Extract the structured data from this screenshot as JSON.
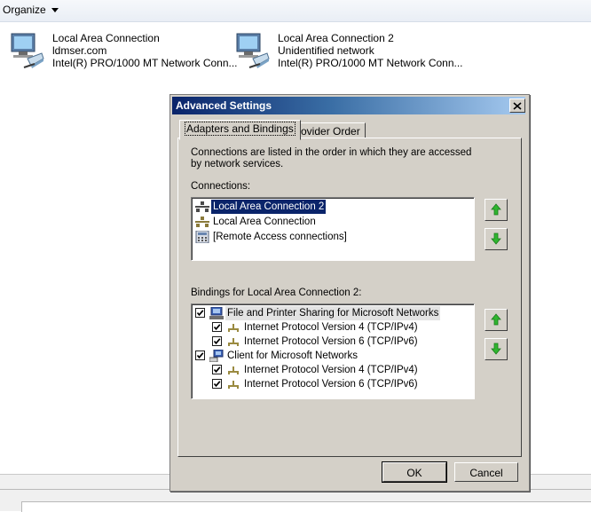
{
  "explorer": {
    "toolbar": {
      "organize_label": "Organize"
    },
    "adapters": [
      {
        "name": "Local Area Connection",
        "status": "ldmser.com",
        "device": "Intel(R) PRO/1000 MT Network Conn..."
      },
      {
        "name": "Local Area Connection 2",
        "status": "Unidentified network",
        "device": "Intel(R) PRO/1000 MT Network Conn..."
      }
    ]
  },
  "dialog": {
    "title": "Advanced Settings",
    "close_label": "×",
    "tabs": [
      {
        "label": "Adapters and Bindings",
        "active": true
      },
      {
        "label": "Provider Order",
        "active": false
      }
    ],
    "description": "Connections are listed in the order in which they are accessed by network services.",
    "connections_label": "Connections:",
    "connections": [
      {
        "label": "Local Area Connection 2",
        "icon": "network-adapter-icon",
        "selected": true
      },
      {
        "label": "Local Area Connection",
        "icon": "network-adapter-icon",
        "selected": false
      },
      {
        "label": "[Remote Access connections]",
        "icon": "remote-access-icon",
        "selected": false
      }
    ],
    "bindings_label": "Bindings for Local Area Connection 2:",
    "bindings": [
      {
        "label": "File and Printer Sharing for Microsoft Networks",
        "level": 0,
        "checked": true,
        "icon": "file-printer-sharing-icon",
        "highlighted": true
      },
      {
        "label": "Internet Protocol Version 4 (TCP/IPv4)",
        "level": 1,
        "checked": true,
        "icon": "protocol-icon",
        "highlighted": false
      },
      {
        "label": "Internet Protocol Version 6 (TCP/IPv6)",
        "level": 1,
        "checked": true,
        "icon": "protocol-icon",
        "highlighted": false
      },
      {
        "label": "Client for Microsoft Networks",
        "level": 0,
        "checked": true,
        "icon": "network-client-icon",
        "highlighted": false
      },
      {
        "label": "Internet Protocol Version 4 (TCP/IPv4)",
        "level": 1,
        "checked": true,
        "icon": "protocol-icon",
        "highlighted": false
      },
      {
        "label": "Internet Protocol Version 6 (TCP/IPv6)",
        "level": 1,
        "checked": true,
        "icon": "protocol-icon",
        "highlighted": false
      }
    ],
    "buttons": {
      "ok": "OK",
      "cancel": "Cancel"
    }
  },
  "colors": {
    "dialog_face": "#d4d0c8",
    "title_gradient_start": "#0a246a",
    "title_gradient_end": "#a6caf0",
    "selection": "#0a246a",
    "arrow_green": "#2fb52f"
  }
}
